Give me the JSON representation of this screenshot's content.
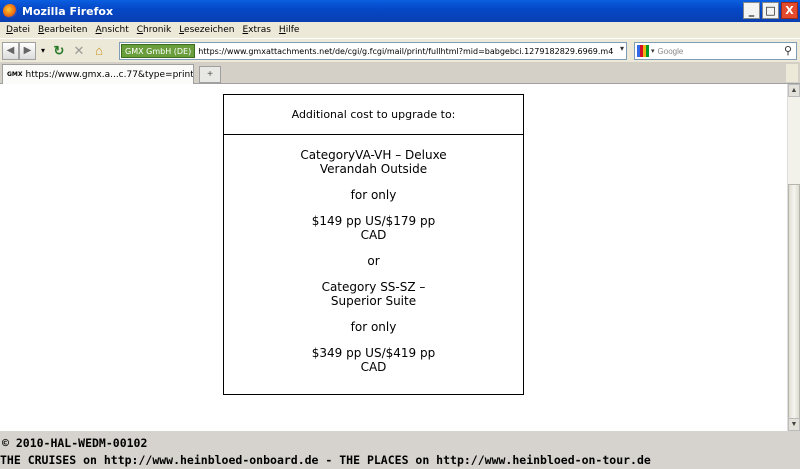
{
  "window": {
    "title": "Mozilla Firefox"
  },
  "window_buttons": [
    "_",
    "□",
    "X"
  ],
  "menu": [
    "Datei",
    "Bearbeiten",
    "Ansicht",
    "Chronik",
    "Lesezeichen",
    "Extras",
    "Hilfe"
  ],
  "nav": {
    "identity_label": "GMX GmbH (DE)",
    "url": "https://www.gmxattachments.net/de/cgi/g.fcgi/mail/print/fullhtml?mid=babgebci.1279182829.6969.m4",
    "search_placeholder": "Google"
  },
  "tab": {
    "favicon_text": "GMX",
    "label": "https://www.gmx.a...c.77&type=print",
    "new_tab": "+"
  },
  "offer": {
    "header": "Additional cost to upgrade to:",
    "option1_line1": "CategoryVA-VH – Deluxe",
    "option1_line2": "Verandah Outside",
    "for_only_1": "for only",
    "price1_line1": "$149 pp US/$179 pp",
    "price1_line2": "CAD",
    "or": "or",
    "option2_line1": "Category SS-SZ –",
    "option2_line2": "Superior Suite",
    "for_only_2": "for only",
    "price2_line1": "$349 pp US/$419 pp",
    "price2_line2": "CAD"
  },
  "footer": {
    "line1": "© 2010-HAL-WEDM-00102",
    "line2": "THE CRUISES on http://www.heinbloed-onboard.de - THE PLACES on http://www.heinbloed-on-tour.de"
  }
}
